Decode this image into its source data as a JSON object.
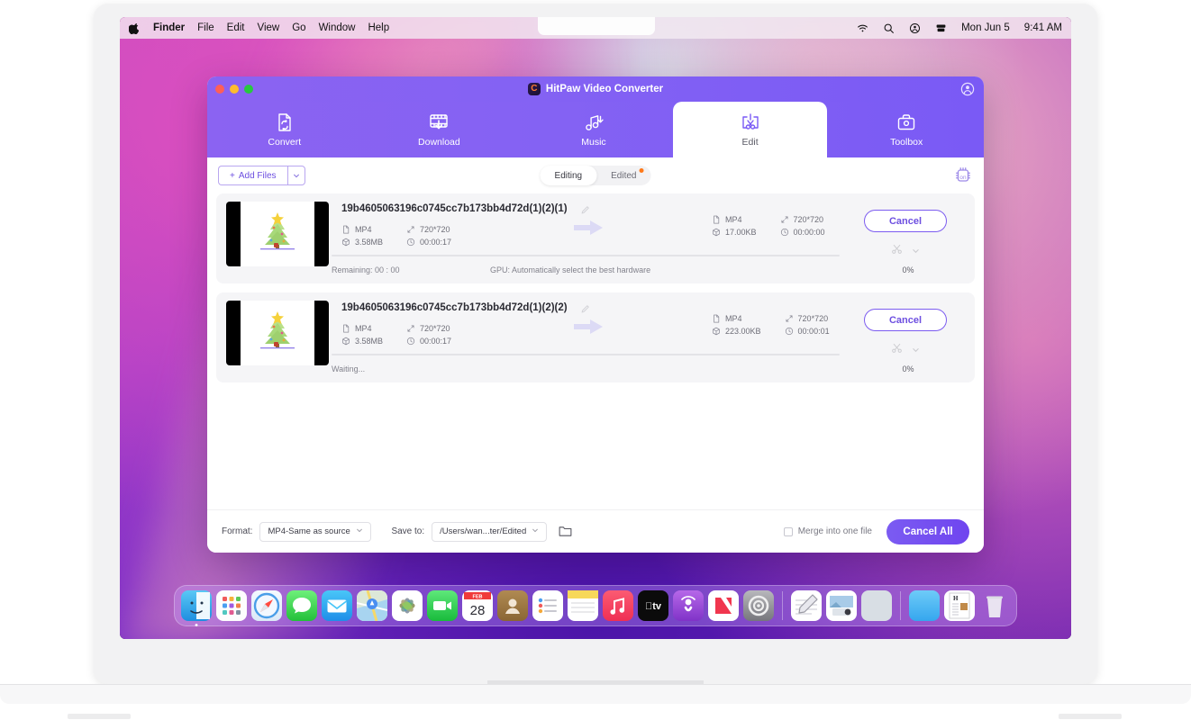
{
  "menubar": {
    "apple_icon": "apple-icon",
    "items": [
      "Finder",
      "File",
      "Edit",
      "View",
      "Go",
      "Window",
      "Help"
    ],
    "status_icons": [
      "wifi-icon",
      "search-icon",
      "control-center-icon",
      "siri-icon"
    ],
    "date": "Mon Jun 5",
    "time": "9:41 AM"
  },
  "app": {
    "title": "HitPaw Video Converter",
    "logo_letter": "C",
    "account_icon": "account-icon",
    "window_controls": [
      "close-button",
      "minimize-button",
      "maximize-button"
    ],
    "nav_tabs": [
      {
        "label": "Convert",
        "icon": "convert-icon",
        "active": false
      },
      {
        "label": "Download",
        "icon": "download-icon",
        "active": false
      },
      {
        "label": "Music",
        "icon": "music-icon",
        "active": false
      },
      {
        "label": "Edit",
        "icon": "edit-icon",
        "active": true
      },
      {
        "label": "Toolbox",
        "icon": "toolbox-icon",
        "active": false
      }
    ],
    "toolbar": {
      "add_files_label": "Add Files",
      "add_files_plus": "+",
      "add_files_caret": "chevron-down-icon",
      "segments": [
        {
          "label": "Editing",
          "active": true,
          "badge": false
        },
        {
          "label": "Edited",
          "active": false,
          "badge": true
        }
      ],
      "gpu_chip_icon": "gpu-chip-on-icon"
    },
    "files": [
      {
        "name": "19b4605063196c0745cc7b173bb4d72d(1)(2)(1)",
        "rename_icon": "rename-pencil-icon",
        "source": {
          "format": "MP4",
          "resolution": "720*720",
          "size": "3.58MB",
          "duration": "00:00:17"
        },
        "output": {
          "format": "MP4",
          "resolution": "720*720",
          "size": "17.00KB",
          "duration": "00:00:00"
        },
        "action_label": "Cancel",
        "status": "Remaining: 00 : 00",
        "gpu": "GPU: Automatically select the best hardware",
        "percent": "0%",
        "progress": 0,
        "actions": [
          "scissors-icon",
          "chevron-down-icon"
        ]
      },
      {
        "name": "19b4605063196c0745cc7b173bb4d72d(1)(2)(2)",
        "rename_icon": "rename-pencil-icon",
        "source": {
          "format": "MP4",
          "resolution": "720*720",
          "size": "3.58MB",
          "duration": "00:00:17"
        },
        "output": {
          "format": "MP4",
          "resolution": "720*720",
          "size": "223.00KB",
          "duration": "00:00:01"
        },
        "action_label": "Cancel",
        "status": "Waiting...",
        "gpu": "",
        "percent": "0%",
        "progress": 0,
        "actions": [
          "scissors-icon",
          "chevron-down-icon"
        ]
      }
    ],
    "bottom_bar": {
      "format_label": "Format:",
      "format_value": "MP4-Same as source",
      "save_to_label": "Save to:",
      "save_to_value": "/Users/wan...ter/Edited",
      "folder_icon": "folder-icon",
      "merge_label": "Merge into one file",
      "merge_checked": false,
      "cancel_all_label": "Cancel All"
    }
  },
  "dock": {
    "items": [
      "finder-icon",
      "launchpad-icon",
      "safari-icon",
      "messages-icon",
      "mail-icon",
      "maps-icon",
      "photos-icon",
      "facetime-icon",
      "calendar-icon",
      "contacts-icon",
      "reminders-icon",
      "notes-icon",
      "music-icon",
      "appletv-icon",
      "podcasts-icon",
      "news-icon",
      "system-settings-icon",
      "divider",
      "textedit-icon",
      "preview-icon",
      "blank-app-icon",
      "divider",
      "downloads-folder-icon",
      "document-icon",
      "trash-icon"
    ],
    "calendar_month": "FEB",
    "calendar_day": "28"
  },
  "colors": {
    "accent": "#7a5af5",
    "accent_light": "#8b63f2",
    "badge": "#ff7a1a"
  }
}
